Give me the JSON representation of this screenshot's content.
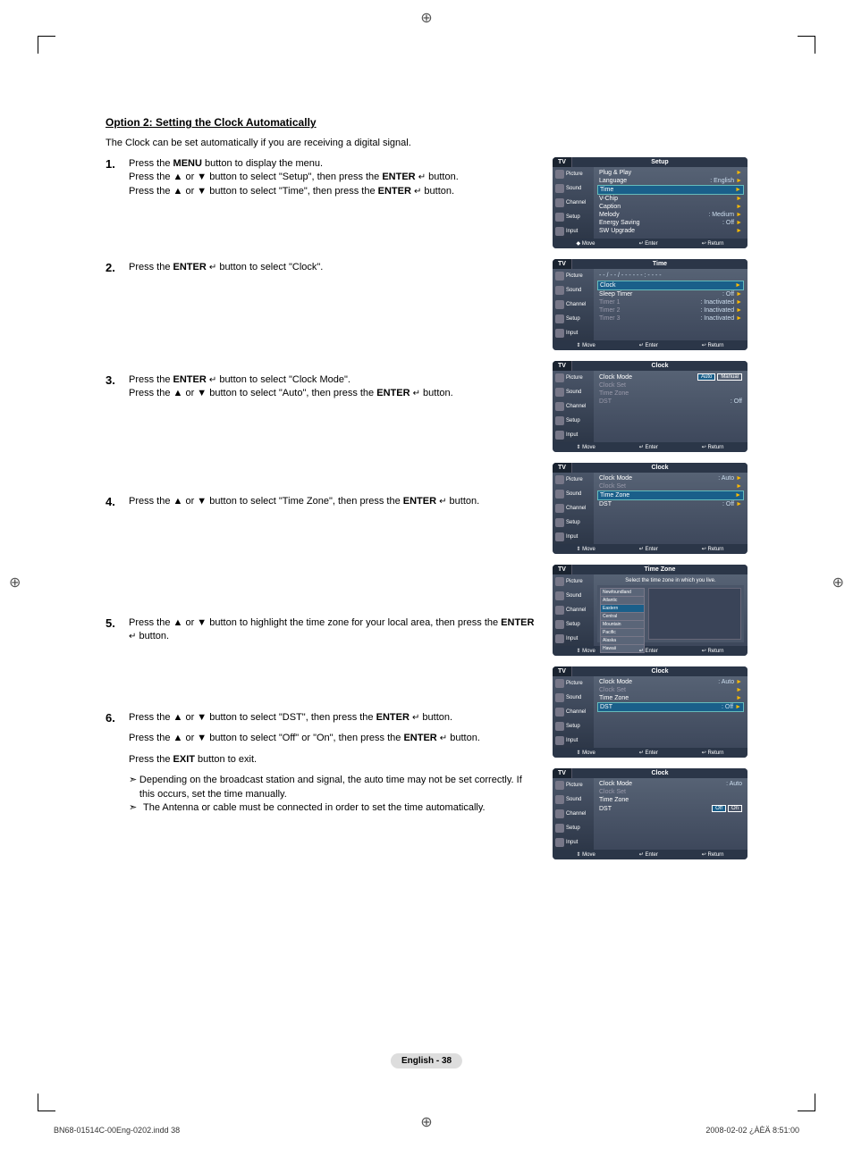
{
  "heading": "Option 2: Setting the Clock Automatically",
  "intro": "The Clock can be set automatically if you are receiving a digital signal.",
  "icons": {
    "enter": "↵",
    "up": "▲",
    "down": "▼",
    "arrow": "➣",
    "play": "►"
  },
  "labels": {
    "menu": "MENU",
    "enter": "ENTER",
    "exit": "EXIT"
  },
  "steps": [
    {
      "num": "1.",
      "lines": [
        {
          "pre": "Press the ",
          "bold": "MENU",
          "post": " button to display the menu."
        },
        {
          "text_a": "Press the ▲ or ▼ button to select \"Setup\", then press the ",
          "bold": "ENTER",
          "text_b": " button.",
          "enter_icon": true
        },
        {
          "text_a": "Press the ▲ or ▼ button to select \"Time\", then press the ",
          "bold": "ENTER",
          "text_b": " button.",
          "enter_icon": true
        }
      ]
    },
    {
      "num": "2.",
      "lines": [
        {
          "text_a": "Press the ",
          "bold": "ENTER",
          "text_b": " button to select \"Clock\".",
          "enter_icon": true
        }
      ]
    },
    {
      "num": "3.",
      "lines": [
        {
          "text_a": "Press the ",
          "bold": "ENTER",
          "text_b": " button to select \"Clock Mode\".",
          "enter_icon": true
        },
        {
          "text_a": "Press the ▲ or ▼ button to select \"Auto\", then press the ",
          "bold": "ENTER",
          "text_b": " button.",
          "enter_icon": true
        }
      ]
    },
    {
      "num": "4.",
      "lines": [
        {
          "text_a": "Press the ▲ or ▼ button to select \"Time Zone\", then press the ",
          "bold": "ENTER",
          "text_b": " button.",
          "enter_icon": true
        }
      ]
    },
    {
      "num": "5.",
      "lines": [
        {
          "text_a": "Press the ▲ or ▼ button to highlight the time zone for your local area, then press the ",
          "bold": "ENTER",
          "text_b": " button.",
          "enter_icon": true
        }
      ]
    },
    {
      "num": "6.",
      "lines": [
        {
          "text_a": "Press the ▲ or ▼ button to select \"DST\", then press the ",
          "bold": "ENTER",
          "text_b": " button.",
          "enter_icon": true
        },
        {
          "text_a": "Press the ▲ or ▼ button to select \"Off\" or \"On\", then press the ",
          "bold": "ENTER",
          "text_b": " button.",
          "enter_icon": true
        },
        {
          "pre": "Press the ",
          "bold": "EXIT",
          "post": " button to exit."
        }
      ],
      "notes": [
        "Depending on the broadcast station and signal, the auto time may not be set correctly. If this occurs, set the time manually.",
        "The Antenna or cable must be connected in order to set the time automatically."
      ]
    }
  ],
  "osd_common": {
    "tv": "TV",
    "side": [
      "Picture",
      "Sound",
      "Channel",
      "Setup",
      "Input"
    ],
    "footer": {
      "move": "Move",
      "enter": "Enter",
      "return": "Return"
    }
  },
  "osd": [
    {
      "title": "Setup",
      "rows": [
        {
          "label": "Plug & Play",
          "val": "",
          "arrow": true
        },
        {
          "label": "Language",
          "val": ": English",
          "arrow": true
        },
        {
          "label": "Time",
          "val": "",
          "arrow": true,
          "hl": true
        },
        {
          "label": "V-Chip",
          "val": "",
          "arrow": true
        },
        {
          "label": "Caption",
          "val": "",
          "arrow": true
        },
        {
          "label": "Melody",
          "val": ": Medium",
          "arrow": true
        },
        {
          "label": "Energy Saving",
          "val": ": Off",
          "arrow": true
        },
        {
          "label": "SW Upgrade",
          "val": "",
          "arrow": true
        }
      ],
      "footer_move_prefix": "◆"
    },
    {
      "title": "Time",
      "top": "- - / - - / - - - -   - - : - -  - -",
      "rows": [
        {
          "label": "Clock",
          "val": "",
          "arrow": true,
          "hl": true
        },
        {
          "label": "Sleep Timer",
          "val": ": Off",
          "arrow": true
        },
        {
          "label": "Timer 1",
          "val": ": Inactivated",
          "arrow": true,
          "dim": true
        },
        {
          "label": "Timer 2",
          "val": ": Inactivated",
          "arrow": true,
          "dim": true
        },
        {
          "label": "Timer 3",
          "val": ": Inactivated",
          "arrow": true,
          "dim": true
        }
      ]
    },
    {
      "title": "Clock",
      "rows": [
        {
          "label": "Clock Mode",
          "opts": [
            "Auto",
            "Manual"
          ],
          "hl_opt": "Auto"
        },
        {
          "label": "Clock Set",
          "val": "",
          "dim": true
        },
        {
          "label": "Time Zone",
          "val": "",
          "dim": true
        },
        {
          "label": "DST",
          "val": ": Off",
          "dim": true
        }
      ]
    },
    {
      "title": "Clock",
      "rows": [
        {
          "label": "Clock Mode",
          "val": ": Auto",
          "arrow": true
        },
        {
          "label": "Clock Set",
          "val": "",
          "arrow": true,
          "dim": true
        },
        {
          "label": "Time Zone",
          "val": "",
          "arrow": true,
          "hl": true
        },
        {
          "label": "DST",
          "val": ": Off",
          "arrow": true
        }
      ]
    },
    {
      "title": "Time Zone",
      "subtitle": "Select the time zone in which you live.",
      "tz_list": [
        "Newfoundland",
        "Atlantic",
        "Eastern",
        "Central",
        "Mountain",
        "Pacific",
        "Alaska",
        "Hawaii"
      ],
      "tz_hl": "Eastern"
    },
    {
      "title": "Clock",
      "rows": [
        {
          "label": "Clock Mode",
          "val": ": Auto",
          "arrow": true
        },
        {
          "label": "Clock Set",
          "val": "",
          "arrow": true,
          "dim": true
        },
        {
          "label": "Time Zone",
          "val": "",
          "arrow": true
        },
        {
          "label": "DST",
          "val": ": Off",
          "arrow": true,
          "hl": true
        }
      ]
    },
    {
      "title": "Clock",
      "rows": [
        {
          "label": "Clock Mode",
          "val": ": Auto"
        },
        {
          "label": "Clock Set",
          "val": "",
          "dim": true
        },
        {
          "label": "Time Zone",
          "val": ""
        },
        {
          "label": "DST",
          "opts": [
            "Off",
            "On"
          ],
          "hl_opt": "Off"
        }
      ]
    }
  ],
  "page_badge": "English - 38",
  "print_left": "BN68-01514C-00Eng-0202.indd   38",
  "print_right": "2008-02-02   ¿ÀÈÄ 8:51:00"
}
